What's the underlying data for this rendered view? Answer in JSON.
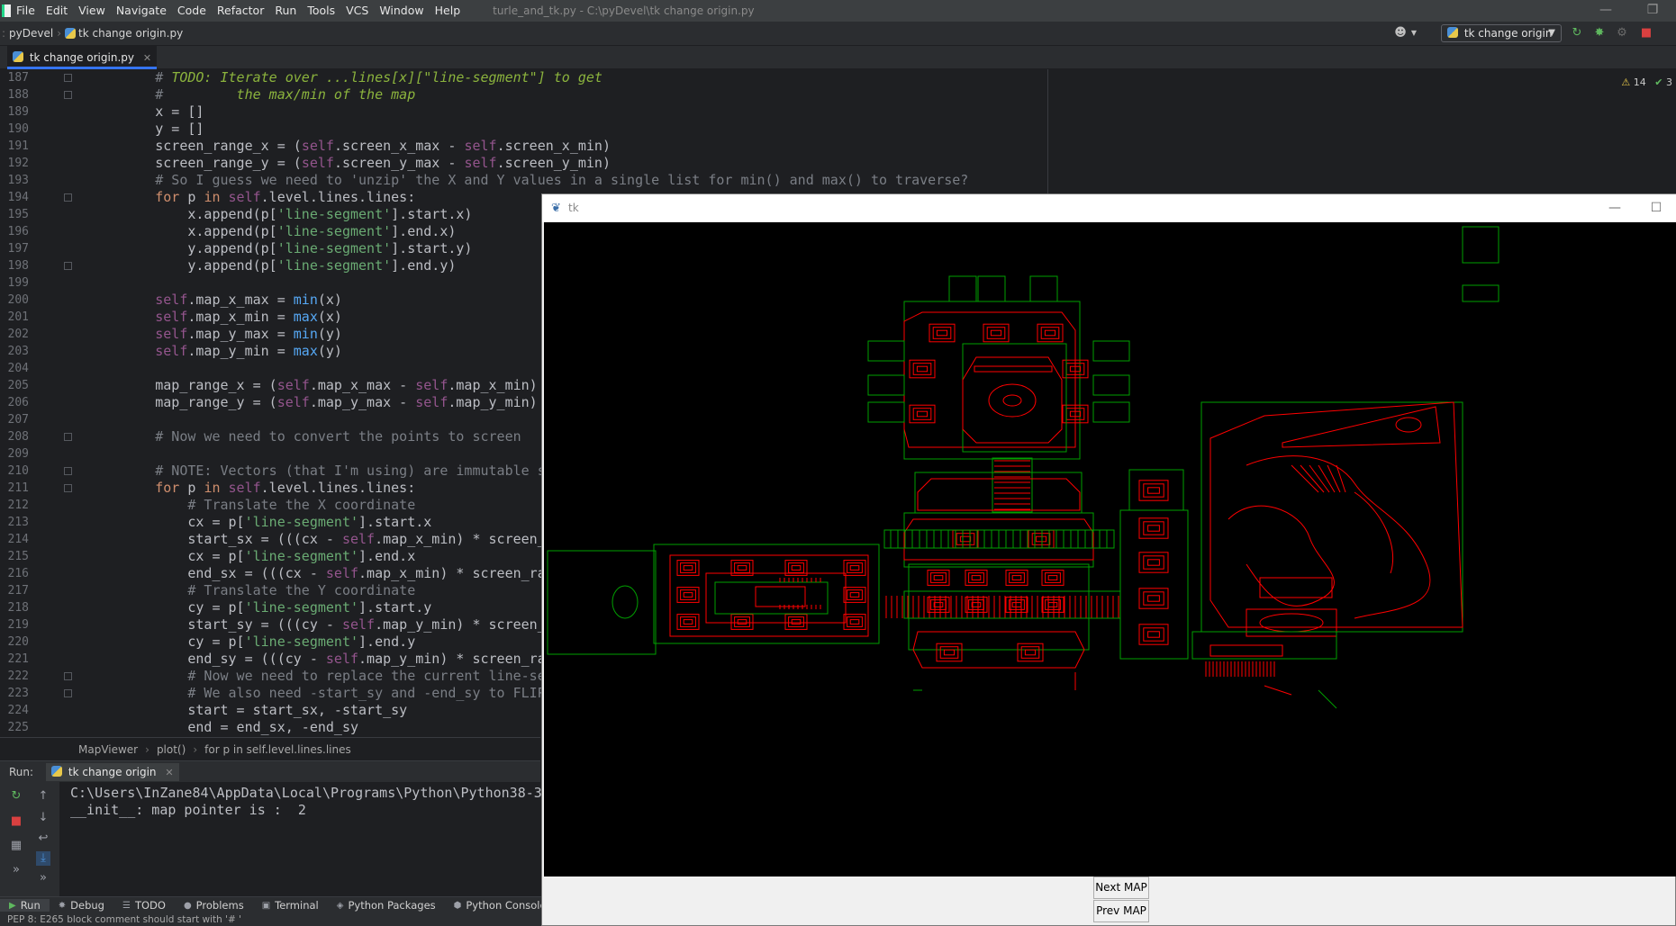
{
  "menubar": {
    "items": [
      "File",
      "Edit",
      "View",
      "Navigate",
      "Code",
      "Refactor",
      "Run",
      "Tools",
      "VCS",
      "Window",
      "Help"
    ],
    "window_title": "turle_and_tk.py - C:\\pyDevel\\tk change origin.py"
  },
  "navbar": {
    "project": "pyDevel",
    "file": "tk change origin.py",
    "run_config": "tk change origin"
  },
  "editor": {
    "tab_label": "tk change origin.py",
    "inspections": {
      "warnings": "14",
      "ok": "3"
    },
    "line_numbers": [
      "187",
      "188",
      "189",
      "190",
      "191",
      "192",
      "193",
      "194",
      "195",
      "196",
      "197",
      "198",
      "199",
      "200",
      "201",
      "202",
      "203",
      "204",
      "205",
      "206",
      "207",
      "208",
      "209",
      "210",
      "211",
      "212",
      "213",
      "214",
      "215",
      "216",
      "217",
      "218",
      "219",
      "220",
      "221",
      "222",
      "223",
      "224",
      "225"
    ],
    "breadcrumb": [
      "MapViewer",
      "plot()",
      "for p in self.level.lines.lines"
    ]
  },
  "code_lines": [
    {
      "i": "        ",
      "t": [
        [
          "cmt",
          "# "
        ],
        [
          "todo",
          "TODO: Iterate over ...lines[x][\"line-segment\"] to get"
        ]
      ]
    },
    {
      "i": "        ",
      "t": [
        [
          "cmt",
          "# "
        ],
        [
          "todo",
          "        the max/min of the map"
        ]
      ]
    },
    {
      "i": "        ",
      "t": [
        [
          "",
          "x = []"
        ]
      ]
    },
    {
      "i": "        ",
      "t": [
        [
          "",
          "y = []"
        ]
      ]
    },
    {
      "i": "        ",
      "t": [
        [
          "",
          "screen_range_x = ("
        ],
        [
          "self",
          "self"
        ],
        [
          "",
          ".screen_x_max - "
        ],
        [
          "self",
          "self"
        ],
        [
          "",
          ".screen_x_min)"
        ]
      ]
    },
    {
      "i": "        ",
      "t": [
        [
          "",
          "screen_range_y = ("
        ],
        [
          "self",
          "self"
        ],
        [
          "",
          ".screen_y_max - "
        ],
        [
          "self",
          "self"
        ],
        [
          "",
          ".screen_y_min)"
        ]
      ]
    },
    {
      "i": "        ",
      "t": [
        [
          "cmt",
          "# So I guess we need to 'unzip' the X and Y values in a single list for min() and max() to traverse?"
        ]
      ]
    },
    {
      "i": "        ",
      "t": [
        [
          "kw",
          "for "
        ],
        [
          "",
          "p "
        ],
        [
          "kw",
          "in "
        ],
        [
          "self",
          "self"
        ],
        [
          "",
          ".level.lines.lines:"
        ]
      ]
    },
    {
      "i": "            ",
      "t": [
        [
          "",
          "x.append(p["
        ],
        [
          "str",
          "'line-segment'"
        ],
        [
          "",
          "].start.x)"
        ]
      ]
    },
    {
      "i": "            ",
      "t": [
        [
          "",
          "x.append(p["
        ],
        [
          "str",
          "'line-segment'"
        ],
        [
          "",
          "].end.x)"
        ]
      ]
    },
    {
      "i": "            ",
      "t": [
        [
          "",
          "y.append(p["
        ],
        [
          "str",
          "'line-segment'"
        ],
        [
          "",
          "].start.y)"
        ]
      ]
    },
    {
      "i": "            ",
      "t": [
        [
          "",
          "y.append(p["
        ],
        [
          "str",
          "'line-segment'"
        ],
        [
          "",
          "].end.y)"
        ]
      ]
    },
    {
      "i": "",
      "t": [
        [
          "",
          ""
        ]
      ]
    },
    {
      "i": "        ",
      "t": [
        [
          "self",
          "self"
        ],
        [
          "",
          ".map_x_max = "
        ],
        [
          "fn",
          "min"
        ],
        [
          "",
          "(x)"
        ]
      ]
    },
    {
      "i": "        ",
      "t": [
        [
          "self",
          "self"
        ],
        [
          "",
          ".map_x_min = "
        ],
        [
          "fn",
          "max"
        ],
        [
          "",
          "(x)"
        ]
      ]
    },
    {
      "i": "        ",
      "t": [
        [
          "self",
          "self"
        ],
        [
          "",
          ".map_y_max = "
        ],
        [
          "fn",
          "min"
        ],
        [
          "",
          "(y)"
        ]
      ]
    },
    {
      "i": "        ",
      "t": [
        [
          "self",
          "self"
        ],
        [
          "",
          ".map_y_min = "
        ],
        [
          "fn",
          "max"
        ],
        [
          "",
          "(y)"
        ]
      ]
    },
    {
      "i": "",
      "t": [
        [
          "",
          ""
        ]
      ]
    },
    {
      "i": "        ",
      "t": [
        [
          "",
          "map_range_x = ("
        ],
        [
          "self",
          "self"
        ],
        [
          "",
          ".map_x_max - "
        ],
        [
          "self",
          "self"
        ],
        [
          "",
          ".map_x_min)"
        ]
      ]
    },
    {
      "i": "        ",
      "t": [
        [
          "",
          "map_range_y = ("
        ],
        [
          "self",
          "self"
        ],
        [
          "",
          ".map_y_max - "
        ],
        [
          "self",
          "self"
        ],
        [
          "",
          ".map_y_min)"
        ]
      ]
    },
    {
      "i": "",
      "t": [
        [
          "",
          ""
        ]
      ]
    },
    {
      "i": "        ",
      "t": [
        [
          "cmt",
          "# Now we need to convert the points to screen"
        ]
      ]
    },
    {
      "i": "",
      "t": [
        [
          "",
          ""
        ]
      ]
    },
    {
      "i": "        ",
      "t": [
        [
          "cmt",
          "# NOTE: Vectors (that I'm using) are immutable so"
        ]
      ]
    },
    {
      "i": "        ",
      "t": [
        [
          "kw",
          "for "
        ],
        [
          "",
          "p "
        ],
        [
          "kw",
          "in "
        ],
        [
          "self",
          "self"
        ],
        [
          "",
          ".level.lines.lines:"
        ]
      ]
    },
    {
      "i": "            ",
      "t": [
        [
          "cmt",
          "# Translate the X coordinate"
        ]
      ]
    },
    {
      "i": "            ",
      "t": [
        [
          "",
          "cx = p["
        ],
        [
          "str",
          "'line-segment'"
        ],
        [
          "",
          "].start.x"
        ]
      ]
    },
    {
      "i": "            ",
      "t": [
        [
          "",
          "start_sx = (((cx - "
        ],
        [
          "self",
          "self"
        ],
        [
          "",
          ".map_x_min) * screen_ra"
        ]
      ]
    },
    {
      "i": "            ",
      "t": [
        [
          "",
          "cx = p["
        ],
        [
          "str",
          "'line-segment'"
        ],
        [
          "",
          "].end.x"
        ]
      ]
    },
    {
      "i": "            ",
      "t": [
        [
          "",
          "end_sx = (((cx - "
        ],
        [
          "self",
          "self"
        ],
        [
          "",
          ".map_x_min) * screen_rang"
        ]
      ]
    },
    {
      "i": "            ",
      "t": [
        [
          "cmt",
          "# Translate the Y coordinate"
        ]
      ]
    },
    {
      "i": "            ",
      "t": [
        [
          "",
          "cy = p["
        ],
        [
          "str",
          "'line-segment'"
        ],
        [
          "",
          "].start.y"
        ]
      ]
    },
    {
      "i": "            ",
      "t": [
        [
          "",
          "start_sy = (((cy - "
        ],
        [
          "self",
          "self"
        ],
        [
          "",
          ".map_y_min) * screen_ra"
        ]
      ]
    },
    {
      "i": "            ",
      "t": [
        [
          "",
          "cy = p["
        ],
        [
          "str",
          "'line-segment'"
        ],
        [
          "",
          "].end.y"
        ]
      ]
    },
    {
      "i": "            ",
      "t": [
        [
          "",
          "end_sy = (((cy - "
        ],
        [
          "self",
          "self"
        ],
        [
          "",
          ".map_y_min) * screen_rang"
        ]
      ]
    },
    {
      "i": "            ",
      "t": [
        [
          "cmt",
          "# Now we need to replace the current line-seg"
        ]
      ]
    },
    {
      "i": "            ",
      "t": [
        [
          "cmt",
          "# We also need -start_sy and -end_sy to FLIP"
        ]
      ]
    },
    {
      "i": "            ",
      "t": [
        [
          "",
          "start = start_sx, -start_sy"
        ]
      ]
    },
    {
      "i": "            ",
      "t": [
        [
          "",
          "end = end_sx, -end_sy"
        ]
      ]
    }
  ],
  "run": {
    "label": "Run:",
    "tab_label": "tk change origin",
    "console_lines": [
      "C:\\Users\\InZane84\\AppData\\Local\\Programs\\Python\\Python38-3",
      "__init__: map pointer is :  2"
    ]
  },
  "bottombar": {
    "items": [
      "Run",
      "Debug",
      "TODO",
      "Problems",
      "Terminal",
      "Python Packages",
      "Python Console"
    ],
    "icons": [
      "run-icon",
      "debug-icon",
      "todo-icon",
      "problems-icon",
      "terminal-icon",
      "packages-icon",
      "python-console-icon"
    ]
  },
  "statusbar": {
    "message": "PEP 8: E265 block comment should start with '# '"
  },
  "tk": {
    "title": "tk",
    "next_button": "Next MAP",
    "prev_button": "Prev MAP"
  },
  "colors": {
    "menubar_bg": "#3c3f41",
    "editor_bg": "#1e1f22",
    "accent": "#3574f0",
    "map_red": "#ff0000",
    "map_green": "#00a000"
  }
}
